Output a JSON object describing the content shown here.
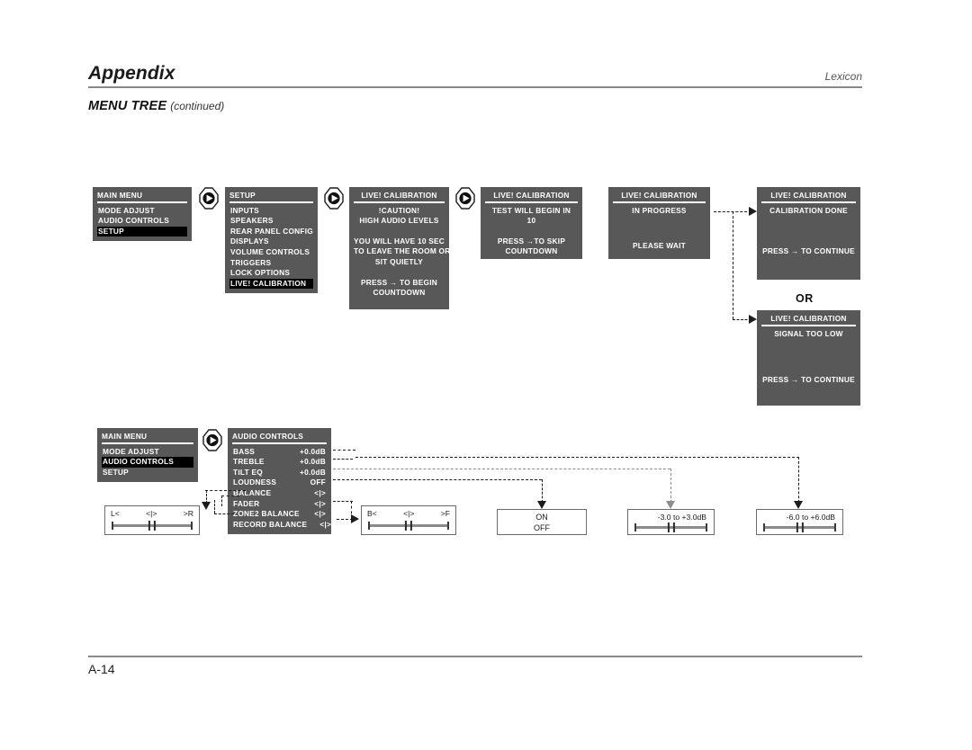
{
  "header": {
    "title": "Appendix",
    "brand": "Lexicon",
    "section_title": "MENU TREE",
    "section_sub": "(continued)"
  },
  "footer": {
    "page": "A-14"
  },
  "labels": {
    "or": "OR"
  },
  "panels": {
    "main_menu_top": {
      "title": "MAIN MENU",
      "items": [
        {
          "label": "MODE ADJUST",
          "highlight": false
        },
        {
          "label": "AUDIO CONTROLS",
          "highlight": false
        },
        {
          "label": "SETUP",
          "highlight": true
        }
      ]
    },
    "setup": {
      "title": "SETUP",
      "items": [
        {
          "label": "INPUTS",
          "highlight": false
        },
        {
          "label": "SPEAKERS",
          "highlight": false
        },
        {
          "label": "REAR PANEL CONFIG",
          "highlight": false
        },
        {
          "label": "DISPLAYS",
          "highlight": false
        },
        {
          "label": "VOLUME CONTROLS",
          "highlight": false
        },
        {
          "label": "TRIGGERS",
          "highlight": false
        },
        {
          "label": "LOCK OPTIONS",
          "highlight": false
        },
        {
          "label": "LIVE! CALIBRATION",
          "highlight": true
        }
      ]
    },
    "caution": {
      "title": "LIVE! CALIBRATION",
      "line1": "!CAUTION!",
      "line2": "HIGH AUDIO LEVELS",
      "line3": "YOU WILL HAVE 10 SEC",
      "line4": "TO LEAVE THE ROOM OR",
      "line5": "SIT QUIETLY",
      "line6": "PRESS → TO BEGIN",
      "line7": "COUNTDOWN"
    },
    "countdown": {
      "title": "LIVE! CALIBRATION",
      "line1": "TEST WILL BEGIN IN",
      "line2": "10",
      "line3": "PRESS →TO SKIP",
      "line4": "COUNTDOWN"
    },
    "in_progress": {
      "title": "LIVE! CALIBRATION",
      "line1": "IN PROGRESS",
      "line2": "PLEASE WAIT"
    },
    "done": {
      "title": "LIVE! CALIBRATION",
      "line1": "CALIBRATION DONE",
      "line2": "PRESS → TO CONTINUE"
    },
    "signal_low": {
      "title": "LIVE! CALIBRATION",
      "line1": "SIGNAL TOO LOW",
      "line2": "PRESS → TO CONTINUE"
    },
    "main_menu_bottom": {
      "title": "MAIN MENU",
      "items": [
        {
          "label": "MODE ADJUST",
          "highlight": false
        },
        {
          "label": "AUDIO CONTROLS",
          "highlight": true
        },
        {
          "label": "SETUP",
          "highlight": false
        }
      ]
    },
    "audio_controls": {
      "title": "AUDIO CONTROLS",
      "rows": [
        {
          "label": "BASS",
          "value": "+0.0dB"
        },
        {
          "label": "TREBLE",
          "value": "+0.0dB"
        },
        {
          "label": "TILT EQ",
          "value": "+0.0dB"
        },
        {
          "label": "LOUDNESS",
          "value": "OFF"
        },
        {
          "label": "BALANCE",
          "value": "<|>"
        },
        {
          "label": "FADER",
          "value": "<|>"
        },
        {
          "label": "ZONE2 BALANCE",
          "value": "<|>"
        },
        {
          "label": "RECORD BALANCE",
          "value": "<|>"
        }
      ]
    }
  },
  "widgets": {
    "balance_slider": {
      "left": "L<",
      "center": "<|>",
      "right": ">R"
    },
    "fader_slider": {
      "left": "B<",
      "center": "<|>",
      "right": ">F"
    },
    "loudness_box": {
      "on": "ON",
      "off": "OFF"
    },
    "range_3db": {
      "label": "-3.0 to +3.0dB"
    },
    "range_6db": {
      "label": "-6.0 to +6.0dB"
    }
  },
  "icons": {
    "next_1": "next-arrow-button-icon",
    "next_2": "next-arrow-button-icon",
    "next_3": "next-arrow-button-icon",
    "next_4": "next-arrow-button-icon"
  }
}
